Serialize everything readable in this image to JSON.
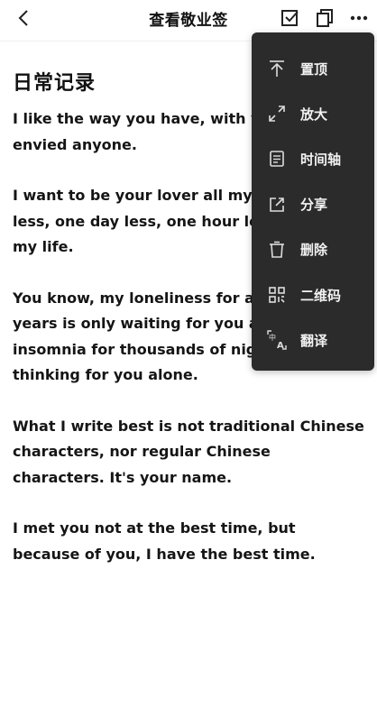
{
  "header": {
    "title": "查看敬业签"
  },
  "note": {
    "title": "日常记录",
    "paragraphs": [
      "I like the way you have, with you, I never envied anyone.",
      "I want to be your lover all my life, one year less, one day less, one hour less, not all my life.",
      "You know, my loneliness for a thousand years is only waiting for you alone, and my insomnia for thousands of nights are only thinking for you alone.",
      "What I write best is not traditional Chinese characters, nor regular Chinese characters. It's your name.",
      "I met you not at the best time, but because of you, I have the best time."
    ]
  },
  "menu": {
    "items": [
      {
        "label": "置顶",
        "icon": "pin-top-icon"
      },
      {
        "label": "放大",
        "icon": "expand-icon"
      },
      {
        "label": "时间轴",
        "icon": "timeline-icon"
      },
      {
        "label": "分享",
        "icon": "share-icon"
      },
      {
        "label": "删除",
        "icon": "delete-icon"
      },
      {
        "label": "二维码",
        "icon": "qrcode-icon"
      },
      {
        "label": "翻译",
        "icon": "translate-icon"
      }
    ]
  },
  "colors": {
    "menu_bg": "#2b2b2b",
    "text": "#111111",
    "background": "#ffffff"
  }
}
